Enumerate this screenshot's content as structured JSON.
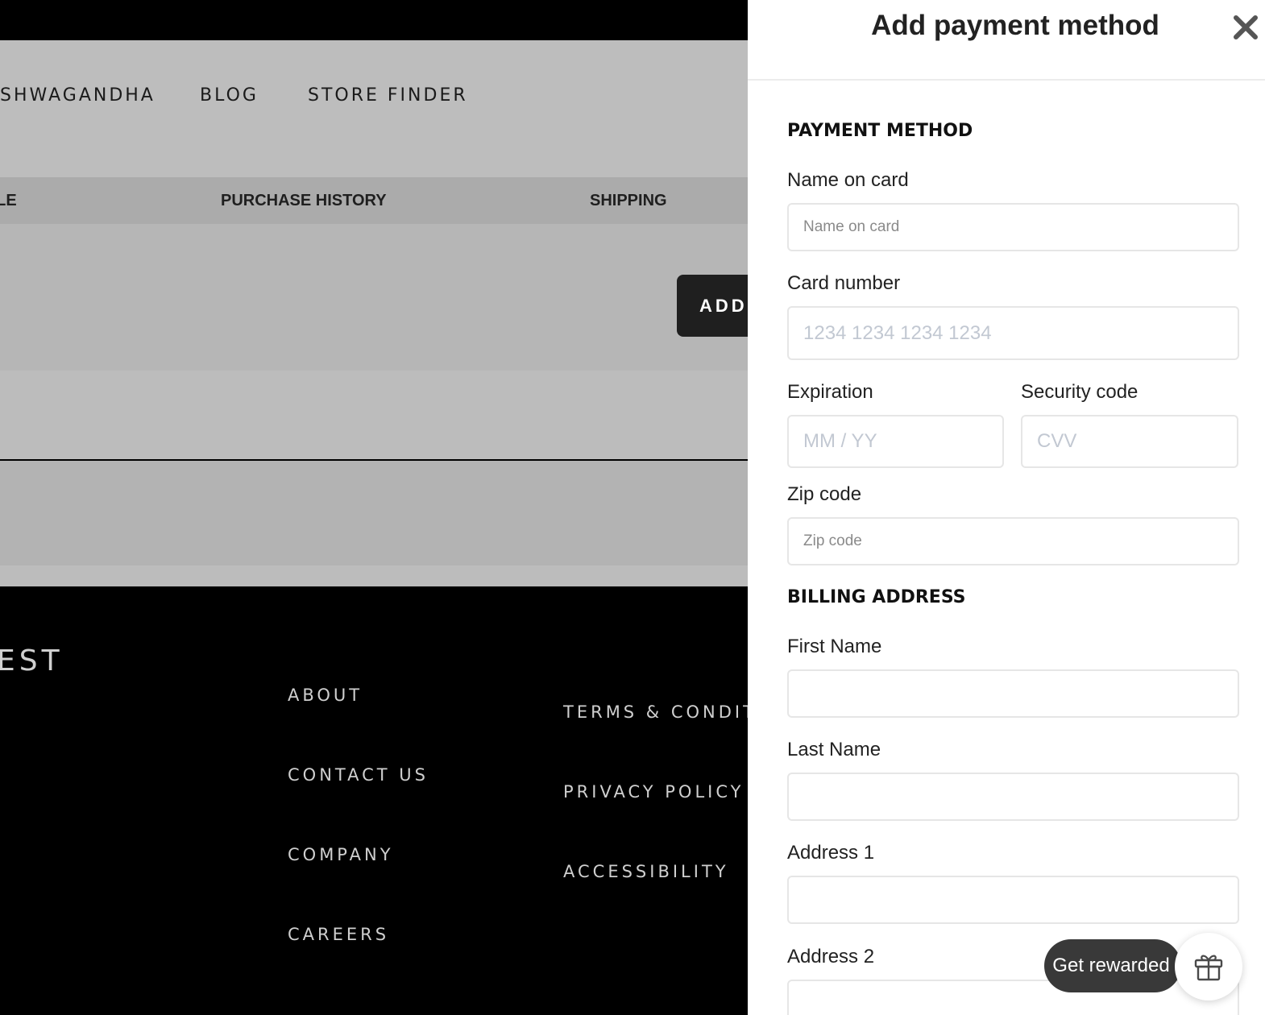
{
  "background_page": {
    "nav": {
      "items": [
        {
          "label": "ASHWAGANDHA"
        },
        {
          "label": "BLOG"
        },
        {
          "label": "STORE FINDER"
        }
      ]
    },
    "tabs": [
      {
        "label": "PROFILE"
      },
      {
        "label": "PURCHASE HISTORY"
      },
      {
        "label": "SHIPPING"
      }
    ],
    "add_button_label": "ADD",
    "footer": {
      "brand": "EST",
      "links_col1": [
        "ABOUT",
        "CONTACT US",
        "COMPANY",
        "CAREERS"
      ],
      "links_col2": [
        "TERMS & CONDITIONS",
        "PRIVACY POLICY",
        "ACCESSIBILITY"
      ]
    }
  },
  "drawer": {
    "title": "Add payment method",
    "close_icon": "close-icon",
    "payment_section": {
      "title": "PAYMENT METHOD",
      "name_on_card": {
        "label": "Name on card",
        "placeholder": "Name on card",
        "value": ""
      },
      "card_number": {
        "label": "Card number",
        "placeholder": "1234 1234 1234 1234",
        "value": ""
      },
      "expiration": {
        "label": "Expiration",
        "placeholder": "MM / YY",
        "value": ""
      },
      "security_code": {
        "label": "Security code",
        "placeholder": "CVV",
        "value": ""
      },
      "zip_code": {
        "label": "Zip code",
        "placeholder": "Zip code",
        "value": ""
      }
    },
    "billing_section": {
      "title": "BILLING ADDRESS",
      "first_name": {
        "label": "First Name",
        "value": ""
      },
      "last_name": {
        "label": "Last Name",
        "value": ""
      },
      "address1": {
        "label": "Address 1",
        "value": ""
      },
      "address2": {
        "label": "Address 2",
        "value": ""
      }
    }
  },
  "rewards": {
    "label": "Get rewarded",
    "icon": "gift-icon"
  },
  "colors": {
    "overlay_gray": "#bdbdbd",
    "footer_black": "#000000",
    "drawer_bg": "#ffffff",
    "pill_bg": "#393939"
  }
}
